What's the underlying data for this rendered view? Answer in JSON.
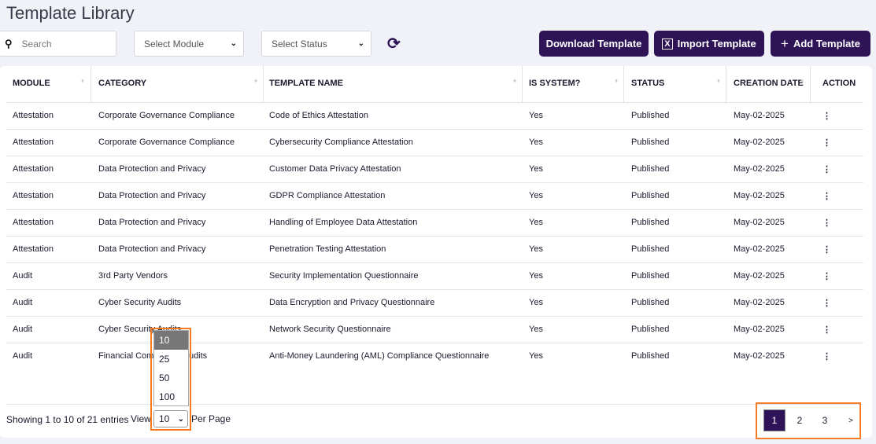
{
  "title": "Template Library",
  "search": {
    "placeholder": "Search",
    "icon": "search-icon"
  },
  "filters": {
    "module": "Select Module",
    "status": "Select Status"
  },
  "buttons": {
    "download": "Download Template",
    "import": "Import Template",
    "add": "Add Template"
  },
  "colors": {
    "primary": "#2e1457",
    "highlight": "#f57c22"
  },
  "table": {
    "headers": [
      "MODULE",
      "CATEGORY",
      "TEMPLATE NAME",
      "IS SYSTEM?",
      "STATUS",
      "CREATION DATE",
      "ACTION"
    ],
    "rows": [
      [
        "Attestation",
        "Corporate Governance Compliance",
        "Code of Ethics Attestation",
        "Yes",
        "Published",
        "May-02-2025"
      ],
      [
        "Attestation",
        "Corporate Governance Compliance",
        "Cybersecurity Compliance Attestation",
        "Yes",
        "Published",
        "May-02-2025"
      ],
      [
        "Attestation",
        "Data Protection and Privacy",
        "Customer Data Privacy Attestation",
        "Yes",
        "Published",
        "May-02-2025"
      ],
      [
        "Attestation",
        "Data Protection and Privacy",
        "GDPR Compliance Attestation",
        "Yes",
        "Published",
        "May-02-2025"
      ],
      [
        "Attestation",
        "Data Protection and Privacy",
        "Handling of Employee Data Attestation",
        "Yes",
        "Published",
        "May-02-2025"
      ],
      [
        "Attestation",
        "Data Protection and Privacy",
        "Penetration Testing Attestation",
        "Yes",
        "Published",
        "May-02-2025"
      ],
      [
        "Audit",
        "3rd Party Vendors",
        "Security Implementation Questionnaire",
        "Yes",
        "Published",
        "May-02-2025"
      ],
      [
        "Audit",
        "Cyber Security Audits",
        "Data Encryption and Privacy Questionnaire",
        "Yes",
        "Published",
        "May-02-2025"
      ],
      [
        "Audit",
        "Cyber Security Audits",
        "Network Security Questionnaire",
        "Yes",
        "Published",
        "May-02-2025"
      ],
      [
        "Audit",
        "Financial Compliance Audits",
        "Anti-Money Laundering (AML) Compliance Questionnaire",
        "Yes",
        "Published",
        "May-02-2025"
      ]
    ]
  },
  "footer": {
    "showing": "Showing 1 to 10 of 21 entries",
    "view": "View",
    "per_page": "Per Page",
    "selected": "10",
    "options": [
      "10",
      "25",
      "50",
      "100"
    ]
  },
  "pagination": {
    "pages": [
      "1",
      "2",
      "3"
    ],
    "current": "1",
    "next": ">"
  }
}
